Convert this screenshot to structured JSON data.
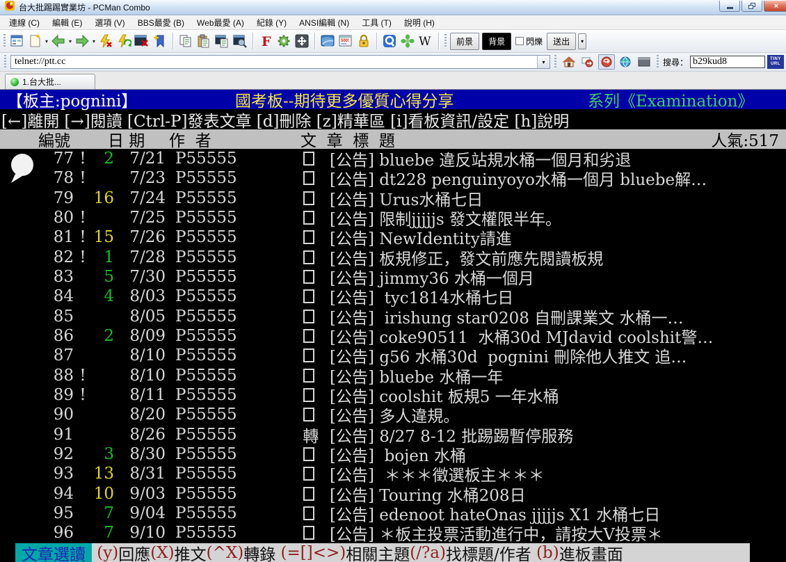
{
  "colors": {
    "bbs_blue": "#0000a8",
    "bbs_yellow": "#f5e642",
    "bbs_green": "#3ecf66",
    "count_green": "#10c020",
    "count_yellow": "#e0d620",
    "status_teal": "#00a8a8",
    "status_chip_text": "#2222b4",
    "key_red": "#8f1f1f"
  },
  "window": {
    "title": "台大批踢踢實業坊 - PCMan Combo"
  },
  "menu_bar": {
    "items": [
      "連線 (C)",
      "編輯 (E)",
      "選項 (V)",
      "BBS最愛 (B)",
      "Web最愛 (A)",
      "紀錄 (Y)",
      "ANSI編輯 (N)",
      "工具 (T)",
      "說明 (H)"
    ]
  },
  "toolbar": {
    "foreground_label": "前景",
    "background_label": "背景",
    "blink_label": "閃爍",
    "send_label": "送出",
    "ansi_icon_text": "500!",
    "wikipedia_label": "W",
    "font_icon_text": "F"
  },
  "address_bar": {
    "url": "telnet://ptt.cc",
    "search_label": "搜尋：",
    "search_value": "b29kud8",
    "tinyurl_line1": "TINY",
    "tinyurl_line2": "URL"
  },
  "tab_bar": {
    "active_tab": "1.台大批..."
  },
  "terminal": {
    "header": {
      "left": "【板主:pognini】",
      "center": "國考板--期待更多優質心得分享",
      "right": "系列《Examination》"
    },
    "hotkeys": "[←]離開 [→]閱讀 [Ctrl-P]發表文章 [d]刪除 [z]精華區 [i]看板資訊/設定 [h]說明",
    "columns": {
      "num": "編號",
      "date": "日 期",
      "author": "作  者",
      "title": "文  章  標  題",
      "popularity": "人氣:517"
    },
    "rows": [
      {
        "num": "77",
        "mark": "!",
        "count": "2",
        "count_color": "green",
        "date": "7/21",
        "author": "P55555",
        "marker": "box",
        "title": "[公告] bluebe 違反站規水桶一個月和劣退"
      },
      {
        "num": "78",
        "mark": "!",
        "count": "",
        "count_color": "",
        "date": "7/23",
        "author": "P55555",
        "marker": "box",
        "title": "[公告] dt228 penguinyoyo水桶一個月 bluebe解…"
      },
      {
        "num": "79",
        "mark": "",
        "count": "16",
        "count_color": "yellow",
        "date": "7/24",
        "author": "P55555",
        "marker": "box",
        "title": "[公告] Urus水桶七日"
      },
      {
        "num": "80",
        "mark": "!",
        "count": "",
        "count_color": "",
        "date": "7/25",
        "author": "P55555",
        "marker": "box",
        "title": "[公告] 限制jjjjjs 發文權限半年。"
      },
      {
        "num": "81",
        "mark": "!",
        "count": "15",
        "count_color": "yellow",
        "date": "7/26",
        "author": "P55555",
        "marker": "box",
        "title": "[公告] NewIdentity請進"
      },
      {
        "num": "82",
        "mark": "!",
        "count": "1",
        "count_color": "green",
        "date": "7/28",
        "author": "P55555",
        "marker": "box",
        "title": "[公告] 板規修正，發文前應先閱讀板規"
      },
      {
        "num": "83",
        "mark": "",
        "count": "5",
        "count_color": "green",
        "date": "7/30",
        "author": "P55555",
        "marker": "box",
        "title": "[公告] jimmy36 水桶一個月"
      },
      {
        "num": "84",
        "mark": "",
        "count": "4",
        "count_color": "green",
        "date": "8/03",
        "author": "P55555",
        "marker": "box",
        "title": "[公告]  tyc1814水桶七日"
      },
      {
        "num": "85",
        "mark": "",
        "count": "",
        "count_color": "",
        "date": "8/05",
        "author": "P55555",
        "marker": "box",
        "title": "[公告]  irishung star0208 自刪課業文 水桶一…"
      },
      {
        "num": "86",
        "mark": "",
        "count": "2",
        "count_color": "green",
        "date": "8/09",
        "author": "P55555",
        "marker": "box",
        "title": "[公告] coke90511  水桶30d MJdavid coolshit警…"
      },
      {
        "num": "87",
        "mark": "",
        "count": "",
        "count_color": "",
        "date": "8/10",
        "author": "P55555",
        "marker": "box",
        "title": "[公告] g56 水桶30d  pognini 刪除他人推文 追…"
      },
      {
        "num": "88",
        "mark": "!",
        "count": "",
        "count_color": "",
        "date": "8/10",
        "author": "P55555",
        "marker": "box",
        "title": "[公告] bluebe 水桶一年"
      },
      {
        "num": "89",
        "mark": "!",
        "count": "",
        "count_color": "",
        "date": "8/11",
        "author": "P55555",
        "marker": "box",
        "title": "[公告] coolshit 板規5 一年水桶"
      },
      {
        "num": "90",
        "mark": "",
        "count": "",
        "count_color": "",
        "date": "8/20",
        "author": "P55555",
        "marker": "box",
        "title": "[公告] 多人違規。"
      },
      {
        "num": "91",
        "mark": "",
        "count": "",
        "count_color": "",
        "date": "8/26",
        "author": "P55555",
        "marker": "轉",
        "title": "[公告] 8/27 8-12 批踢踢暫停服務"
      },
      {
        "num": "92",
        "mark": "",
        "count": "3",
        "count_color": "green",
        "date": "8/30",
        "author": "P55555",
        "marker": "box",
        "title": "[公告]  bojen 水桶"
      },
      {
        "num": "93",
        "mark": "",
        "count": "13",
        "count_color": "yellow",
        "date": "8/31",
        "author": "P55555",
        "marker": "box",
        "title": "[公告]  ＊＊＊徵選板主＊＊＊"
      },
      {
        "num": "94",
        "mark": "",
        "count": "10",
        "count_color": "yellow",
        "date": "9/03",
        "author": "P55555",
        "marker": "box",
        "title": "[公告] Touring 水桶208日"
      },
      {
        "num": "95",
        "mark": "",
        "count": "7",
        "count_color": "green",
        "date": "9/04",
        "author": "P55555",
        "marker": "box",
        "title": "[公告] edenoot hateOnas jjjjjs X1 水桶七日"
      },
      {
        "num": "96",
        "mark": "",
        "count": "7",
        "count_color": "green",
        "date": "9/10",
        "author": "P55555",
        "marker": "box",
        "title": "[公告] ＊板主投票活動進行中，請按大V投票＊"
      }
    ],
    "status_bar": {
      "mode": "文章選讀",
      "segments": [
        {
          "text": " (y)",
          "color": "red"
        },
        {
          "text": "回應",
          "color": "black"
        },
        {
          "text": "(X)",
          "color": "red"
        },
        {
          "text": "推文",
          "color": "black"
        },
        {
          "text": "(^X)",
          "color": "red"
        },
        {
          "text": "轉錄 ",
          "color": "black"
        },
        {
          "text": "(=[]<>)",
          "color": "red"
        },
        {
          "text": "相關主題",
          "color": "black"
        },
        {
          "text": "(/?a)",
          "color": "red"
        },
        {
          "text": "找標題/作者 ",
          "color": "black"
        },
        {
          "text": "(b)",
          "color": "red"
        },
        {
          "text": "進板畫面",
          "color": "black"
        }
      ]
    }
  }
}
